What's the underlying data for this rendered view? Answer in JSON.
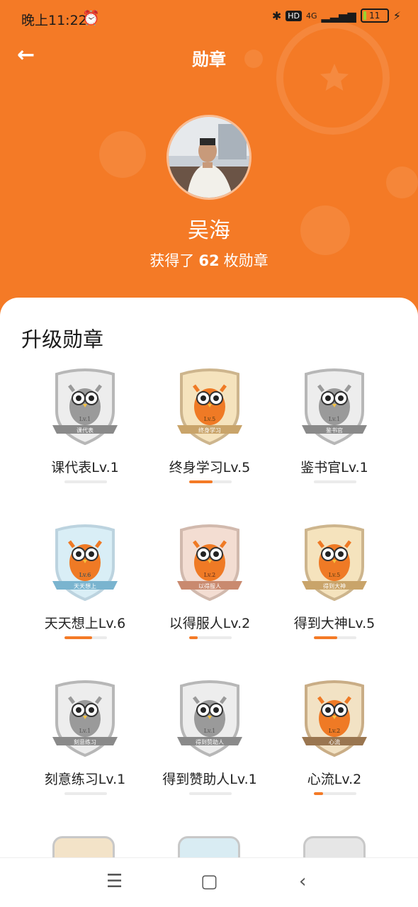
{
  "status_bar": {
    "time": "晚上11:22",
    "alarm_icon": "alarm-clock-icon",
    "network": "4G",
    "hd": "HD",
    "battery": "11"
  },
  "nav": {
    "title": "勋章",
    "back_icon": "arrow-left-icon"
  },
  "profile": {
    "name": "吴海",
    "count_prefix": "获得了",
    "count": "62",
    "count_suffix": "枚勋章"
  },
  "section": {
    "title": "升级勋章"
  },
  "badges": [
    {
      "label": "课代表Lv.1",
      "ribbon": "课代表",
      "level": "Lv.1",
      "progress": 0.0,
      "color": "gray"
    },
    {
      "label": "终身学习Lv.5",
      "ribbon": "终身学习",
      "level": "Lv.5",
      "progress": 0.55,
      "color": "gold"
    },
    {
      "label": "鉴书官Lv.1",
      "ribbon": "鉴书官",
      "level": "Lv.1",
      "progress": 0.0,
      "color": "gray"
    },
    {
      "label": "天天想上Lv.6",
      "ribbon": "天天想上",
      "level": "Lv.6",
      "progress": 0.65,
      "color": "blue"
    },
    {
      "label": "以得服人Lv.2",
      "ribbon": "以得服人",
      "level": "Lv.2",
      "progress": 0.2,
      "color": "rose"
    },
    {
      "label": "得到大神Lv.5",
      "ribbon": "得到大神",
      "level": "Lv.5",
      "progress": 0.55,
      "color": "gold"
    },
    {
      "label": "刻意练习Lv.1",
      "ribbon": "刻意练习",
      "level": "Lv.1",
      "progress": 0.0,
      "color": "gray"
    },
    {
      "label": "得到赞助人Lv.1",
      "ribbon": "得到赞助人",
      "level": "Lv.1",
      "progress": 0.0,
      "color": "gray"
    },
    {
      "label": "心流Lv.2",
      "ribbon": "心流",
      "level": "Lv.2",
      "progress": 0.22,
      "color": "brown"
    }
  ],
  "colors": {
    "brand_orange": "#f47a26",
    "progress_track": "#ebebeb"
  },
  "bottom_nav": {
    "menu_icon": "menu-icon",
    "home_icon": "square-home-icon",
    "back_icon": "chevron-left-icon"
  }
}
